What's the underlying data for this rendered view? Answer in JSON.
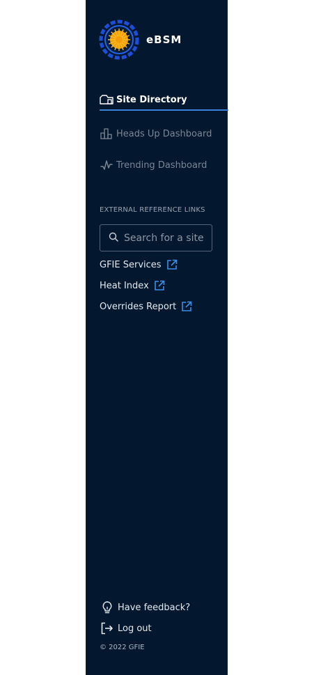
{
  "brand": {
    "name": "eBSM",
    "logo_icon": "sun-gear-logo-icon",
    "accent_color": "#f59e0b",
    "ring_color": "#2563eb"
  },
  "nav": {
    "items": [
      {
        "label": "Site Directory",
        "icon": "site-building-icon",
        "active": true
      },
      {
        "label": "Heads Up Dashboard",
        "icon": "bar-chart-icon",
        "active": false
      },
      {
        "label": "Trending Dashboard",
        "icon": "pulse-line-icon",
        "active": false
      }
    ],
    "active_color": "#3b82d6"
  },
  "external": {
    "heading": "EXTERNAL REFERENCE LINKS",
    "search_placeholder": "Search for a site",
    "links": [
      {
        "label": "GFIE Services",
        "icon": "external-link-icon"
      },
      {
        "label": "Heat Index",
        "icon": "external-link-icon"
      },
      {
        "label": "Overrides Report",
        "icon": "external-link-icon"
      }
    ],
    "link_icon_color": "#3b8fe8"
  },
  "footer": {
    "feedback_label": "Have feedback?",
    "feedback_icon": "lightbulb-icon",
    "logout_label": "Log out",
    "logout_icon": "logout-arrow-icon",
    "copyright": "© 2022 GFIE"
  },
  "colors": {
    "sidebar_bg": "#03182f",
    "page_bg": "#ffffff"
  }
}
